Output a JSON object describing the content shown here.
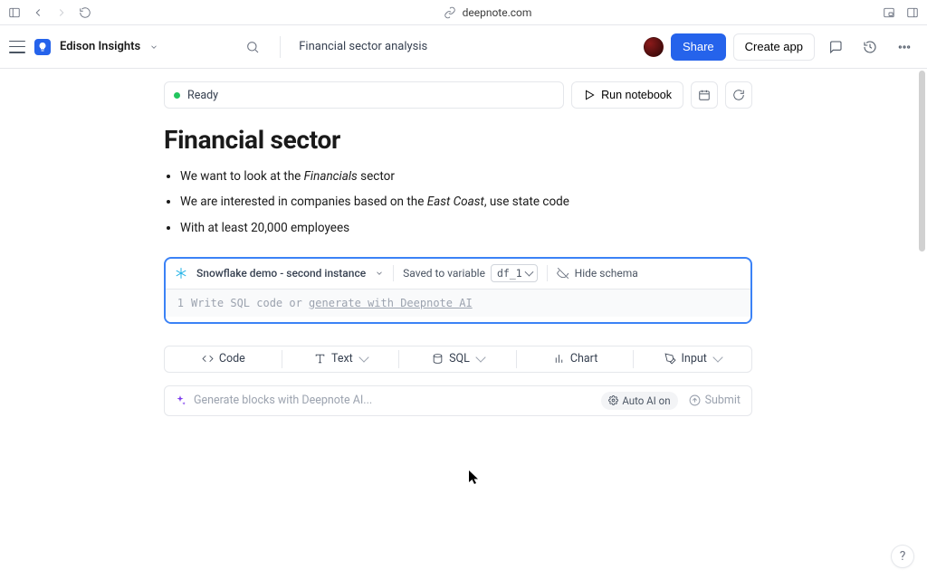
{
  "browser": {
    "domain": "deepnote.com"
  },
  "app": {
    "workspace": "Edison Insights",
    "notebook_title": "Financial sector analysis",
    "share": "Share",
    "create_app": "Create app"
  },
  "status": {
    "ready": "Ready",
    "run": "Run notebook"
  },
  "doc": {
    "title": "Financial sector",
    "bullet1_pre": "We want to look at the ",
    "bullet1_em": "Financials",
    "bullet1_post": " sector",
    "bullet2_pre": "We are interested in companies based on the ",
    "bullet2_em": "East Coast",
    "bullet2_post": ", use state code",
    "bullet3": "With at least 20,000 employees"
  },
  "sql": {
    "connection": "Snowflake demo - second instance",
    "saved_label": "Saved to variable",
    "variable": "df_1",
    "hide_schema": "Hide schema",
    "line_no": "1",
    "placeholder_pre": "Write SQL code or ",
    "placeholder_link": "generate with Deepnote AI"
  },
  "block_types": {
    "code": "Code",
    "text": "Text",
    "sql": "SQL",
    "chart": "Chart",
    "input": "Input"
  },
  "ai": {
    "placeholder": "Generate blocks with Deepnote AI...",
    "auto": "Auto AI on",
    "submit": "Submit"
  },
  "help": "?"
}
